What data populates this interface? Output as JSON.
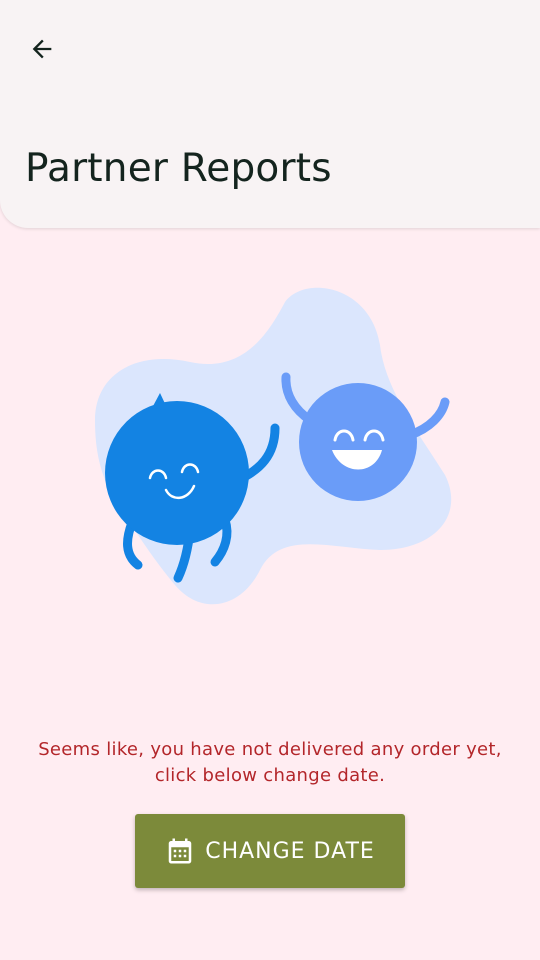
{
  "header": {
    "back_icon": "arrow-left-icon",
    "title": "Partner Reports"
  },
  "empty_state": {
    "illustration": "two-happy-blobs-illustration",
    "message": "Seems like, you have not delivered any order yet, click below change date."
  },
  "change_date_button": {
    "icon": "calendar-icon",
    "label": "CHANGE DATE"
  },
  "colors": {
    "background": "#ffedf2",
    "app_bar": "#f8f3f4",
    "title_text": "#14241e",
    "message_text": "#b3262a",
    "button": "#7c8a3a",
    "blob_dark": "#1383e3",
    "blob_light": "#6a9cf8",
    "splash": "#dbe6fd"
  }
}
